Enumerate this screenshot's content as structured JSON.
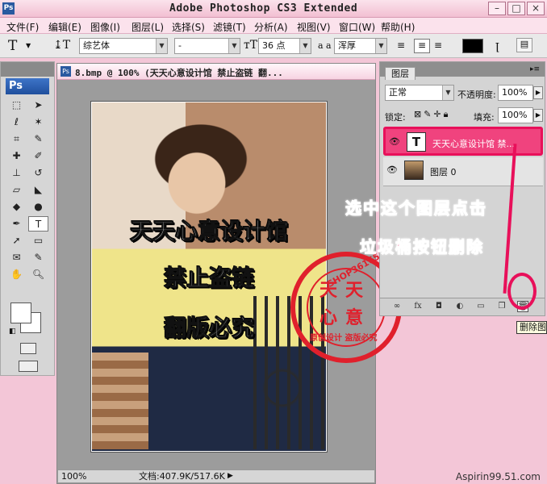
{
  "window": {
    "title": "Adobe Photoshop CS3 Extended",
    "app_icon": "Ps"
  },
  "menu": [
    "文件(F)",
    "编辑(E)",
    "图像(I)",
    "图层(L)",
    "选择(S)",
    "滤镜(T)",
    "分析(A)",
    "视图(V)",
    "窗口(W)",
    "帮助(H)"
  ],
  "options_bar": {
    "font_family": "综艺体",
    "font_style": "-",
    "font_size": "36 点",
    "aa_label": "a a",
    "antialias": "浑厚",
    "color": "#000000"
  },
  "toolbox": {
    "logo": "Ps"
  },
  "document": {
    "tab_title": "8.bmp @ 100% (天天心意设计馆 禁止盗链 翻...",
    "zoom": "100%",
    "doc_info": "文档:407.9K/517.6K",
    "watermark": [
      "天天心意设计馆",
      "禁止盗链",
      "翻版必究"
    ],
    "stamp": {
      "ring_text": "SHOP361653 38",
      "center": [
        "天",
        "天",
        "心",
        "意"
      ],
      "bottom_text": "原创设计 盗版必究"
    }
  },
  "layers_panel": {
    "tab": "图层",
    "blend_mode": "正常",
    "opacity_label": "不透明度:",
    "opacity": "100%",
    "lock_label": "锁定:",
    "fill_label": "填充:",
    "fill": "100%",
    "layers": [
      {
        "name": "天天心意设计馆 禁...",
        "kind": "text",
        "thumb": "T",
        "selected": true
      },
      {
        "name": "图层 0",
        "kind": "image",
        "thumb": "",
        "selected": false
      }
    ]
  },
  "annotation": {
    "line1": "选中这个图层点击",
    "line2": "垃圾桶按钮删除"
  },
  "tooltip": "删除图",
  "footer": {
    "url": "Aspirin99.51.com"
  }
}
